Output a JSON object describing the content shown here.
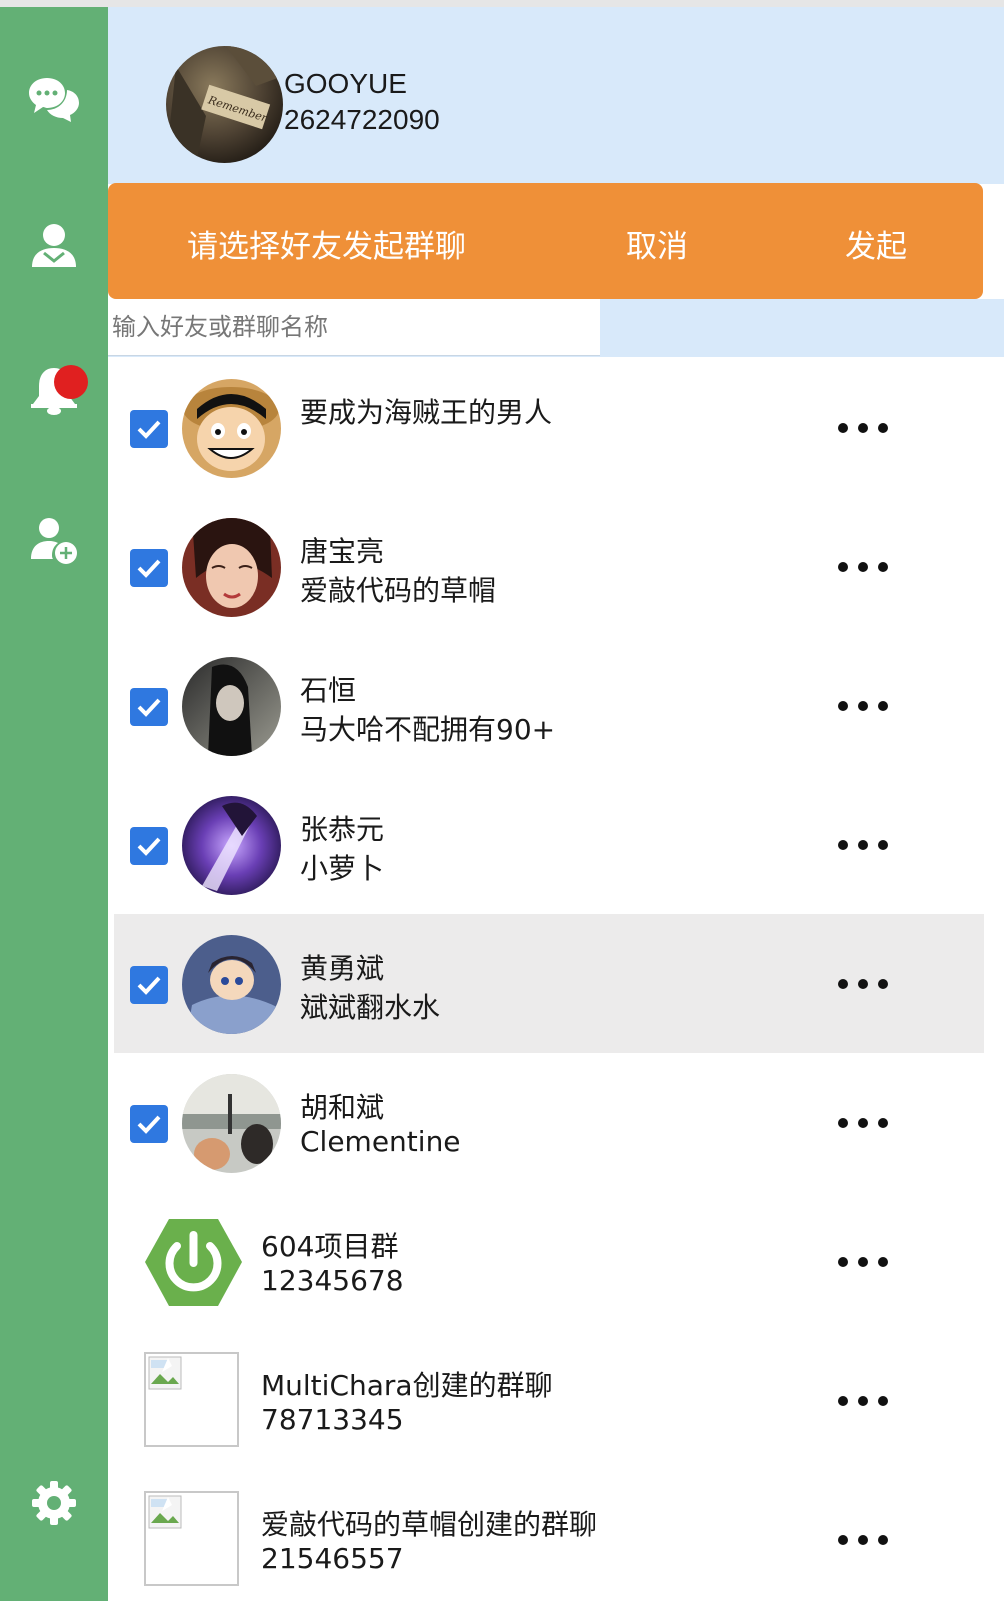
{
  "profile": {
    "name": "GOOYUE",
    "id": "2624722090",
    "avatar_tag": "Remember"
  },
  "sidebar": {
    "items": [
      {
        "icon": "chat-icon"
      },
      {
        "icon": "contacts-icon"
      },
      {
        "icon": "notification-bell-icon",
        "badge": true
      },
      {
        "icon": "add-friend-icon"
      }
    ],
    "settings_icon": "gear-icon"
  },
  "toolbar": {
    "prompt": "请选择好友发起群聊",
    "cancel_label": "取消",
    "start_label": "发起"
  },
  "search": {
    "placeholder": "输入好友或群聊名称",
    "value": ""
  },
  "friends": [
    {
      "name": "要成为海贼王的男人",
      "sub": "",
      "checked": true
    },
    {
      "name": "唐宝亮",
      "sub": "爱敲代码的草帽",
      "checked": true
    },
    {
      "name": "石恒",
      "sub": "马大哈不配拥有90+",
      "checked": true
    },
    {
      "name": "张恭元",
      "sub": "小萝卜",
      "checked": true
    },
    {
      "name": "黄勇斌",
      "sub": "斌斌翻水水",
      "checked": true
    },
    {
      "name": "胡和斌",
      "sub": "Clementine",
      "checked": true
    }
  ],
  "groups": [
    {
      "name": "604项目群",
      "sub": "12345678"
    },
    {
      "name": "MultiChara创建的群聊",
      "sub": "78713345"
    },
    {
      "name": "爱敲代码的草帽创建的群聊",
      "sub": "21546557"
    }
  ],
  "colors": {
    "sidebar": "#63b075",
    "header_bg": "#d8e9fa",
    "toolbar": "#ef9038",
    "checkbox": "#2f78e0",
    "badge": "#e02020",
    "hover_row": "#ecebeb"
  }
}
